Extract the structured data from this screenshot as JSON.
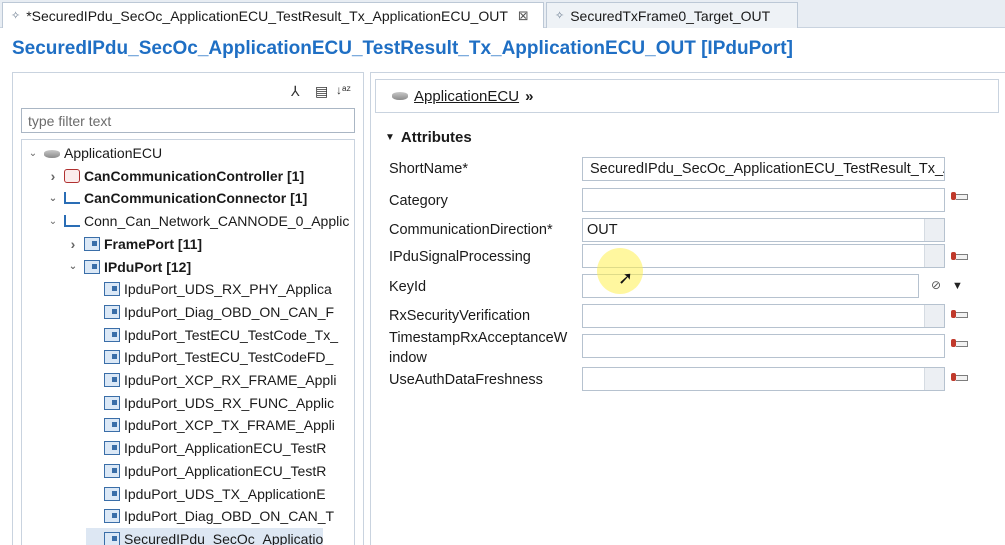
{
  "tabs": [
    {
      "label": "*SecuredIPdu_SecOc_ApplicationECU_TestResult_Tx_ApplicationECU_OUT",
      "close": "⊠"
    },
    {
      "label": "SecuredTxFrame0_Target_OUT"
    }
  ],
  "editor_title": "SecuredIPdu_SecOc_ApplicationECU_TestResult_Tx_ApplicationECU_OUT [IPduPort]",
  "left_panel": {
    "filter_placeholder": "type filter text",
    "tree": [
      {
        "label": "ApplicationECU",
        "twisty": "expanded",
        "icon": "ecu-icon",
        "bold": false,
        "indent": 0
      },
      {
        "label": "CanCommunicationController [1]",
        "twisty": "collapsed",
        "icon": "controller-icon",
        "bold": true,
        "indent": 1
      },
      {
        "label": "CanCommunicationConnector [1]",
        "twisty": "expanded",
        "icon": "connector-icon",
        "bold": true,
        "indent": 1
      },
      {
        "label": "Conn_Can_Network_CANNODE_0_Applic",
        "twisty": "expanded",
        "icon": "connector-icon",
        "bold": false,
        "indent": 2
      },
      {
        "label": "FramePort [11]",
        "twisty": "collapsed",
        "icon": "port-icon",
        "bold": true,
        "indent": 3
      },
      {
        "label": "IPduPort [12]",
        "twisty": "expanded",
        "icon": "port-icon",
        "bold": true,
        "indent": 3
      },
      {
        "label": "IpduPort_UDS_RX_PHY_Applica",
        "icon": "port-icon",
        "indent": 4
      },
      {
        "label": "IpduPort_Diag_OBD_ON_CAN_F",
        "icon": "port-icon",
        "indent": 4
      },
      {
        "label": "IpduPort_TestECU_TestCode_Tx_",
        "icon": "port-icon",
        "indent": 4
      },
      {
        "label": "IpduPort_TestECU_TestCodeFD_",
        "icon": "port-icon",
        "indent": 4
      },
      {
        "label": "IpduPort_XCP_RX_FRAME_Appli",
        "icon": "port-icon",
        "indent": 4
      },
      {
        "label": "IpduPort_UDS_RX_FUNC_Applic",
        "icon": "port-icon",
        "indent": 4
      },
      {
        "label": "IpduPort_XCP_TX_FRAME_Appli",
        "icon": "port-icon",
        "indent": 4
      },
      {
        "label": "IpduPort_ApplicationECU_TestR",
        "icon": "port-icon",
        "indent": 4
      },
      {
        "label": "IpduPort_ApplicationECU_TestR",
        "icon": "port-icon",
        "indent": 4
      },
      {
        "label": "IpduPort_UDS_TX_ApplicationE",
        "icon": "port-icon",
        "indent": 4
      },
      {
        "label": "IpduPort_Diag_OBD_ON_CAN_T",
        "icon": "port-icon",
        "indent": 4
      },
      {
        "label": "SecuredIPdu_SecOc_Applicatio",
        "icon": "port-icon",
        "indent": 4,
        "selected": true
      }
    ]
  },
  "breadcrumb": {
    "label": "ApplicationECU",
    "chevron": "»"
  },
  "attributes": {
    "section_title": "Attributes",
    "rows": [
      {
        "label": "ShortName*",
        "value": "SecuredIPdu_SecOc_ApplicationECU_TestResult_Tx_Ap"
      },
      {
        "label": "Category",
        "value": ""
      },
      {
        "label": "CommunicationDirection*",
        "value": "OUT"
      },
      {
        "label": "IPduSignalProcessing",
        "value": ""
      },
      {
        "label": "KeyId",
        "value": ""
      },
      {
        "label": "RxSecurityVerification",
        "value": ""
      },
      {
        "label": "TimestampRxAcceptanceWindow",
        "label_line1": "TimestampRxAcceptanceW",
        "label_line2": "indow",
        "value": ""
      },
      {
        "label": "UseAuthDataFreshness",
        "value": ""
      }
    ]
  }
}
